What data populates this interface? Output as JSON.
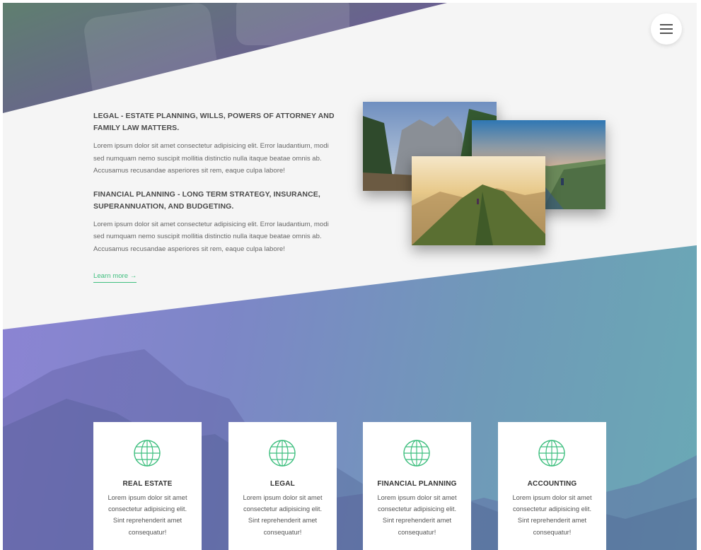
{
  "header": {
    "menu_icon": "hamburger-menu-icon"
  },
  "intro": {
    "sections": [
      {
        "title": "LEGAL - ESTATE PLANNING, WILLS, POWERS OF ATTORNEY AND FAMILY LAW MATTERS.",
        "text": "Lorem ipsum dolor sit amet consectetur adipisicing elit. Error laudantium, modi sed numquam nemo suscipit mollitia distinctio nulla itaque beatae omnis ab. Accusamus recusandae asperiores sit rem, eaque culpa labore!"
      },
      {
        "title": "FINANCIAL PLANNING - LONG TERM STRATEGY, INSURANCE, SUPERANNUATION, AND BUDGETING.",
        "text": "Lorem ipsum dolor sit amet consectetur adipisicing elit. Error laudantium, modi sed numquam nemo suscipit mollitia distinctio nulla itaque beatae omnis ab. Accusamus recusandae asperiores sit rem, eaque culpa labore!"
      }
    ],
    "learn_more": "Learn more →"
  },
  "services": [
    {
      "icon": "globe-icon",
      "title": "REAL ESTATE",
      "text": "Lorem ipsum dolor sit amet consectetur adipisicing elit. Sint reprehenderit amet consequatur!"
    },
    {
      "icon": "globe-icon",
      "title": "LEGAL",
      "text": "Lorem ipsum dolor sit amet consectetur adipisicing elit. Sint reprehenderit amet consequatur!"
    },
    {
      "icon": "globe-icon",
      "title": "FINANCIAL PLANNING",
      "text": "Lorem ipsum dolor sit amet consectetur adipisicing elit. Sint reprehenderit amet consequatur!"
    },
    {
      "icon": "globe-icon",
      "title": "ACCOUNTING",
      "text": "Lorem ipsum dolor sit amet consectetur adipisicing elit. Sint reprehenderit amet consequatur!"
    }
  ],
  "colors": {
    "accent": "#3fbf7f",
    "heading": "#4a4a4a",
    "gradient_start": "#8f84d6",
    "gradient_end": "#6aa9b5"
  }
}
